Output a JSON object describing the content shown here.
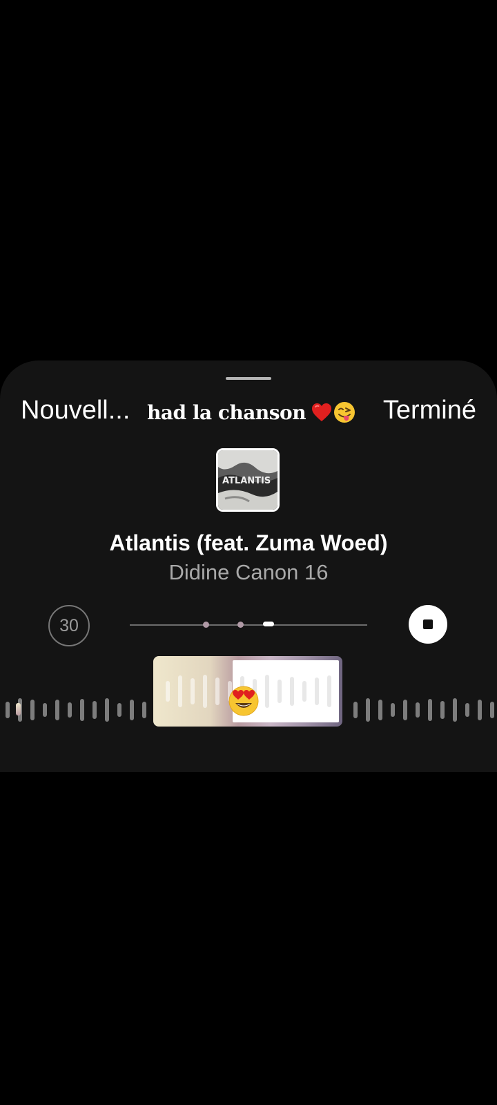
{
  "header": {
    "left_button": "Nouvell...",
    "caption": "had la chanson",
    "caption_emojis": [
      "heart-icon",
      "winking-face-tongue-icon"
    ],
    "right_button": "Terminé"
  },
  "track": {
    "title": "Atlantis (feat. Zuma Woed)",
    "artist": "Didine Canon 16",
    "album_art_text": "ATLANTIS"
  },
  "controls": {
    "duration_seconds": "30",
    "stop_icon": "stop-icon"
  },
  "sticker": {
    "emoji": "smiling-face-heart-eyes-icon"
  },
  "colors": {
    "sheet_background": "#141414",
    "accent_gradient_start": "#efe7cc",
    "accent_gradient_end": "#6f6580",
    "marker": "#b09aa6"
  }
}
